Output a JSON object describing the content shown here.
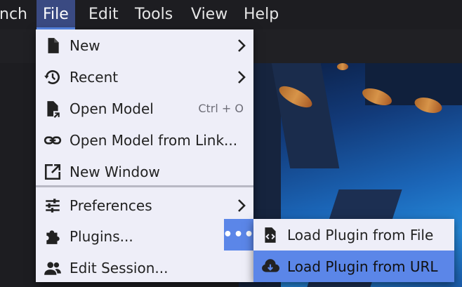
{
  "menubar": {
    "items": [
      {
        "label": "nch"
      },
      {
        "label": "File"
      },
      {
        "label": "Edit"
      },
      {
        "label": "Tools"
      },
      {
        "label": "View"
      },
      {
        "label": "Help"
      }
    ]
  },
  "file_menu": {
    "items": [
      {
        "label": "New",
        "icon": "file-icon",
        "submenu": true
      },
      {
        "label": "Recent",
        "icon": "history-icon",
        "submenu": true
      },
      {
        "label": "Open Model",
        "icon": "open-file-icon",
        "shortcut": "Ctrl + O"
      },
      {
        "label": "Open Model from Link...",
        "icon": "link-icon"
      },
      {
        "label": "New Window",
        "icon": "new-window-icon"
      },
      {
        "label": "Preferences",
        "icon": "sliders-icon",
        "submenu": true
      },
      {
        "label": "Plugins...",
        "icon": "puzzle-icon"
      },
      {
        "label": "Edit Session...",
        "icon": "users-icon"
      }
    ],
    "more_label": "•••"
  },
  "plugins_submenu": {
    "items": [
      {
        "label": "Load Plugin from File",
        "icon": "file-code-icon"
      },
      {
        "label": "Load Plugin from URL",
        "icon": "cloud-download-icon"
      }
    ]
  },
  "colors": {
    "menu_bg": "#eeeef8",
    "highlight": "#5b86e8",
    "menubar_bg": "#1d1d21",
    "active_tab": "#3a4a82"
  }
}
